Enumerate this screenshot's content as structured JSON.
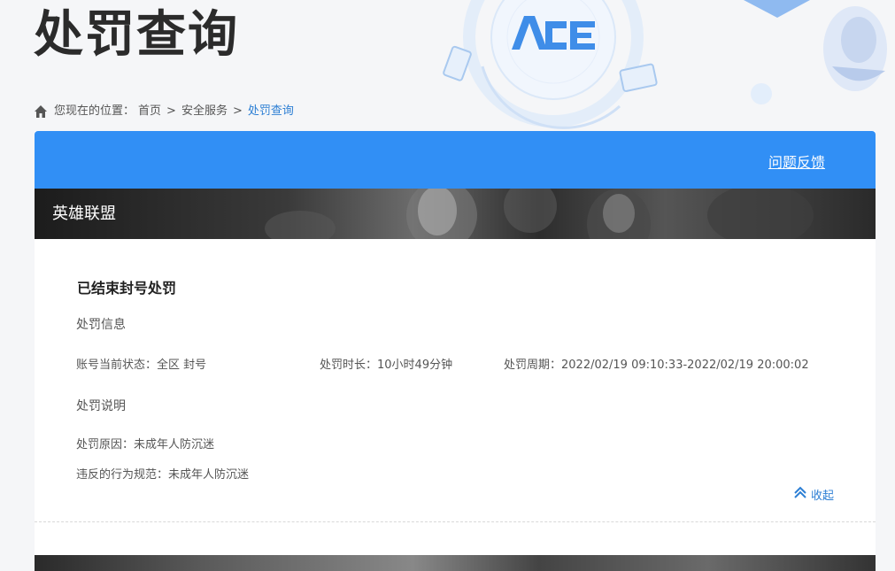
{
  "page": {
    "title": "处罚查询"
  },
  "breadcrumb": {
    "prefix": "您现在的位置：",
    "items": [
      "首页",
      "安全服务",
      "处罚查询"
    ],
    "separator": ">"
  },
  "header": {
    "feedback_label": "问题反馈"
  },
  "game": {
    "name": "英雄联盟"
  },
  "record": {
    "title": "已结束封号处罚",
    "info_heading": "处罚信息",
    "status_label": "账号当前状态：",
    "status_value": "全区 封号",
    "duration_label": "处罚时长：",
    "duration_value": "10小时49分钟",
    "period_label": "处罚周期：",
    "period_value": "2022/02/19 09:10:33-2022/02/19 20:00:02",
    "desc_heading": "处罚说明",
    "reason_label": "处罚原因：",
    "reason_value": "未成年人防沉迷",
    "rule_label": "违反的行为规范：",
    "rule_value": "未成年人防沉迷",
    "collapse_label": "收起"
  },
  "colors": {
    "primary": "#318ff5",
    "link": "#2d7fd4",
    "title": "#2b2b2b"
  }
}
